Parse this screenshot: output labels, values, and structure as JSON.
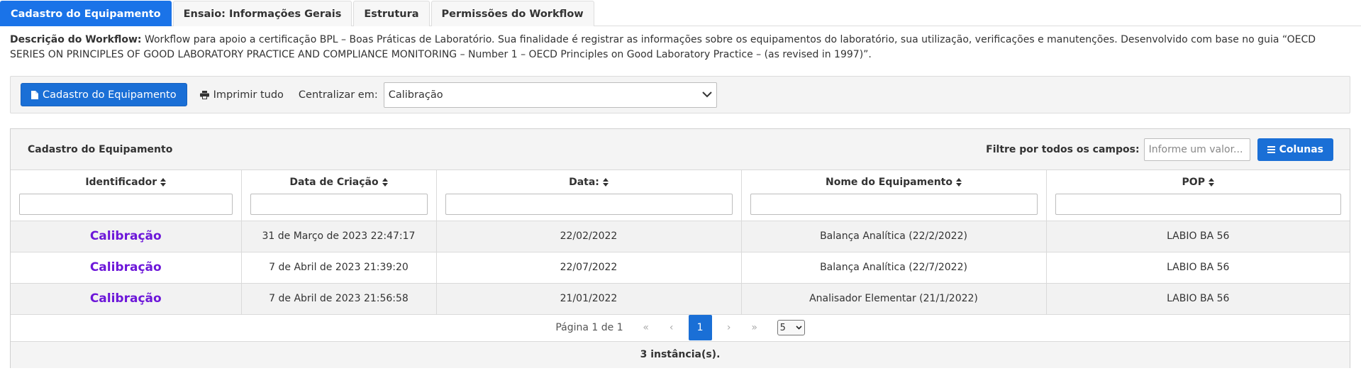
{
  "tabs": [
    {
      "label": "Cadastro do Equipamento",
      "active": true
    },
    {
      "label": "Ensaio: Informações Gerais",
      "active": false
    },
    {
      "label": "Estrutura",
      "active": false
    },
    {
      "label": "Permissões do Workflow",
      "active": false
    }
  ],
  "description": {
    "label": "Descrição do Workflow:",
    "text": "Workflow para apoio a certificação BPL – Boas Práticas de Laboratório. Sua finalidade é registrar as informações sobre os equipamentos do laboratório, sua utilização, verificações e manutenções. Desenvolvido com base no guia “OECD SERIES ON PRINCIPLES OF GOOD LABORATORY PRACTICE AND COMPLIANCE MONITORING – Number 1 – OECD Principles on Good Laboratory Practice – (as revised in 1997)”."
  },
  "toolbar": {
    "primary_button": "Cadastro do Equipamento",
    "primary_icon": "file-icon",
    "print_label": "Imprimir tudo",
    "print_icon": "print-icon",
    "center_label": "Centralizar em:",
    "center_value": "Calibração"
  },
  "panel": {
    "title": "Cadastro do Equipamento",
    "filter_label": "Filtre por todos os campos:",
    "filter_placeholder": "Informe um valor...",
    "columns_button": "Colunas"
  },
  "table": {
    "columns": [
      "Identificador",
      "Data de Criação",
      "Data:",
      "Nome do Equipamento",
      "POP"
    ],
    "rows": [
      [
        "Calibração",
        "31 de Março de 2023 22:47:17",
        "22/02/2022",
        "Balança Analítica (22/2/2022)",
        "LABIO BA 56"
      ],
      [
        "Calibração",
        "7 de Abril de 2023 21:39:20",
        "22/07/2022",
        "Balança Analítica (22/7/2022)",
        "LABIO BA 56"
      ],
      [
        "Calibração",
        "7 de Abril de 2023 21:56:58",
        "21/01/2022",
        "Analisador Elementar (21/1/2022)",
        "LABIO BA 56"
      ]
    ]
  },
  "pagination": {
    "text": "Página 1 de 1",
    "current_page": "1",
    "page_size": "5"
  },
  "footer": {
    "count_text": "3 instância(s)."
  },
  "colors": {
    "accent": "#1a6fd6",
    "link": "#6d17d9",
    "header_bg": "#f4f4f4"
  }
}
